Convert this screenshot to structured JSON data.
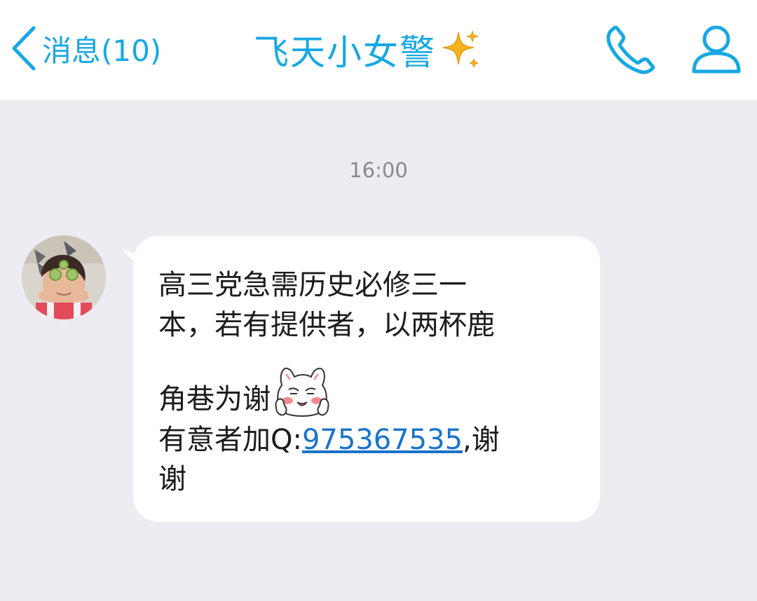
{
  "header": {
    "back_label": "消息(10)",
    "title": "飞天小女警",
    "title_decoration_icon": "sparkle-icon",
    "call_icon": "phone-icon",
    "profile_icon": "profile-icon",
    "accent_color": "#17a8e3"
  },
  "chat": {
    "timestamp": "16:00",
    "message": {
      "line1": "高三党急需历史必修三一",
      "line2": "本，若有提供者，以两杯鹿",
      "line3": "角巷为谢",
      "line3_sticker": "cat-blushing-sticker",
      "line4_prefix": "有意者加Q:",
      "line4_link": "975367535",
      "line4_suffix": ",谢",
      "line5": "谢"
    },
    "link_color": "#1a73c9"
  }
}
